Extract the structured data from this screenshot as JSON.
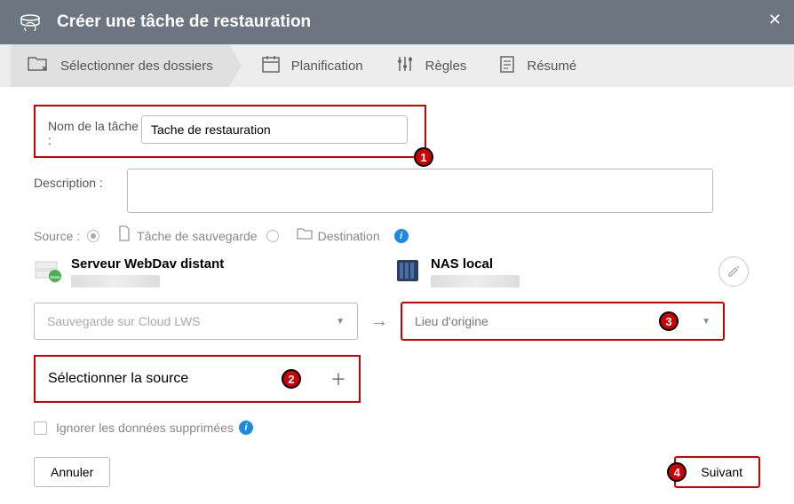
{
  "header": {
    "title": "Créer une tâche de restauration"
  },
  "tabs": [
    {
      "label": "Sélectionner des dossiers"
    },
    {
      "label": "Planification"
    },
    {
      "label": "Règles"
    },
    {
      "label": "Résumé"
    }
  ],
  "form": {
    "name_label": "Nom de la tâche :",
    "name_value": "Tache de restauration",
    "desc_label": "Description :",
    "desc_value": ""
  },
  "source": {
    "label": "Source :",
    "opt_backup": "Tâche de sauvegarde",
    "opt_dest": "Destination"
  },
  "devices": {
    "src_title": "Serveur WebDav distant",
    "dst_title": "NAS local"
  },
  "selects": {
    "src_backup": "Sauvegarde sur Cloud LWS",
    "dest_location": "Lieu d'origine",
    "select_source": "Sélectionner la source"
  },
  "ignore": {
    "label": "Ignorer les données supprimées"
  },
  "footer": {
    "cancel": "Annuler",
    "next": "Suivant"
  },
  "badges": {
    "b1": "1",
    "b2": "2",
    "b3": "3",
    "b4": "4"
  }
}
